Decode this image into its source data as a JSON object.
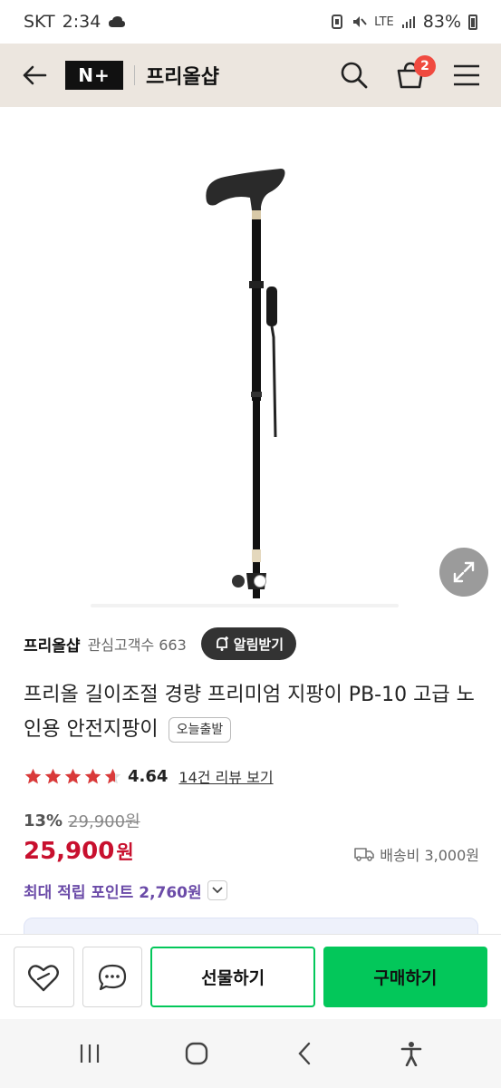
{
  "status_bar": {
    "carrier": "SKT",
    "time": "2:34",
    "network": "LTE",
    "battery": "83%"
  },
  "header": {
    "brand_logo": "N+",
    "store_name": "프리올샵",
    "cart_count": "2",
    "icons": [
      "arrow-left-icon",
      "search-icon",
      "cart-icon",
      "menu-icon"
    ]
  },
  "gallery": {
    "total_images": 2,
    "current_index": 1
  },
  "seller": {
    "name": "프리올샵",
    "followers": "관심고객수 663",
    "notify_label": "알림받기"
  },
  "product": {
    "title": "프리올 길이조절 경량 프리미엄 지팡이 PB-10 고급 노인용 안전지팡이",
    "badge": "오늘출발",
    "rating_value": 4.64,
    "rating_text": "4.64",
    "review_link": "14건 리뷰 보기",
    "discount_rate": "13%",
    "original_price": "29,900원",
    "sale_price": "25,900",
    "price_unit": "원",
    "shipping": "배송비 3,000원",
    "points": "최대 적립 포인트 2,760원"
  },
  "actions": {
    "gift_label": "선물하기",
    "buy_label": "구매하기"
  },
  "colors": {
    "header_bg": "#ece6df",
    "accent_green": "#03c75a",
    "price_red": "#c8102e",
    "points_purple": "#6b4ba8",
    "star_red": "#d93a3a",
    "badge_red": "#f04a3f"
  }
}
